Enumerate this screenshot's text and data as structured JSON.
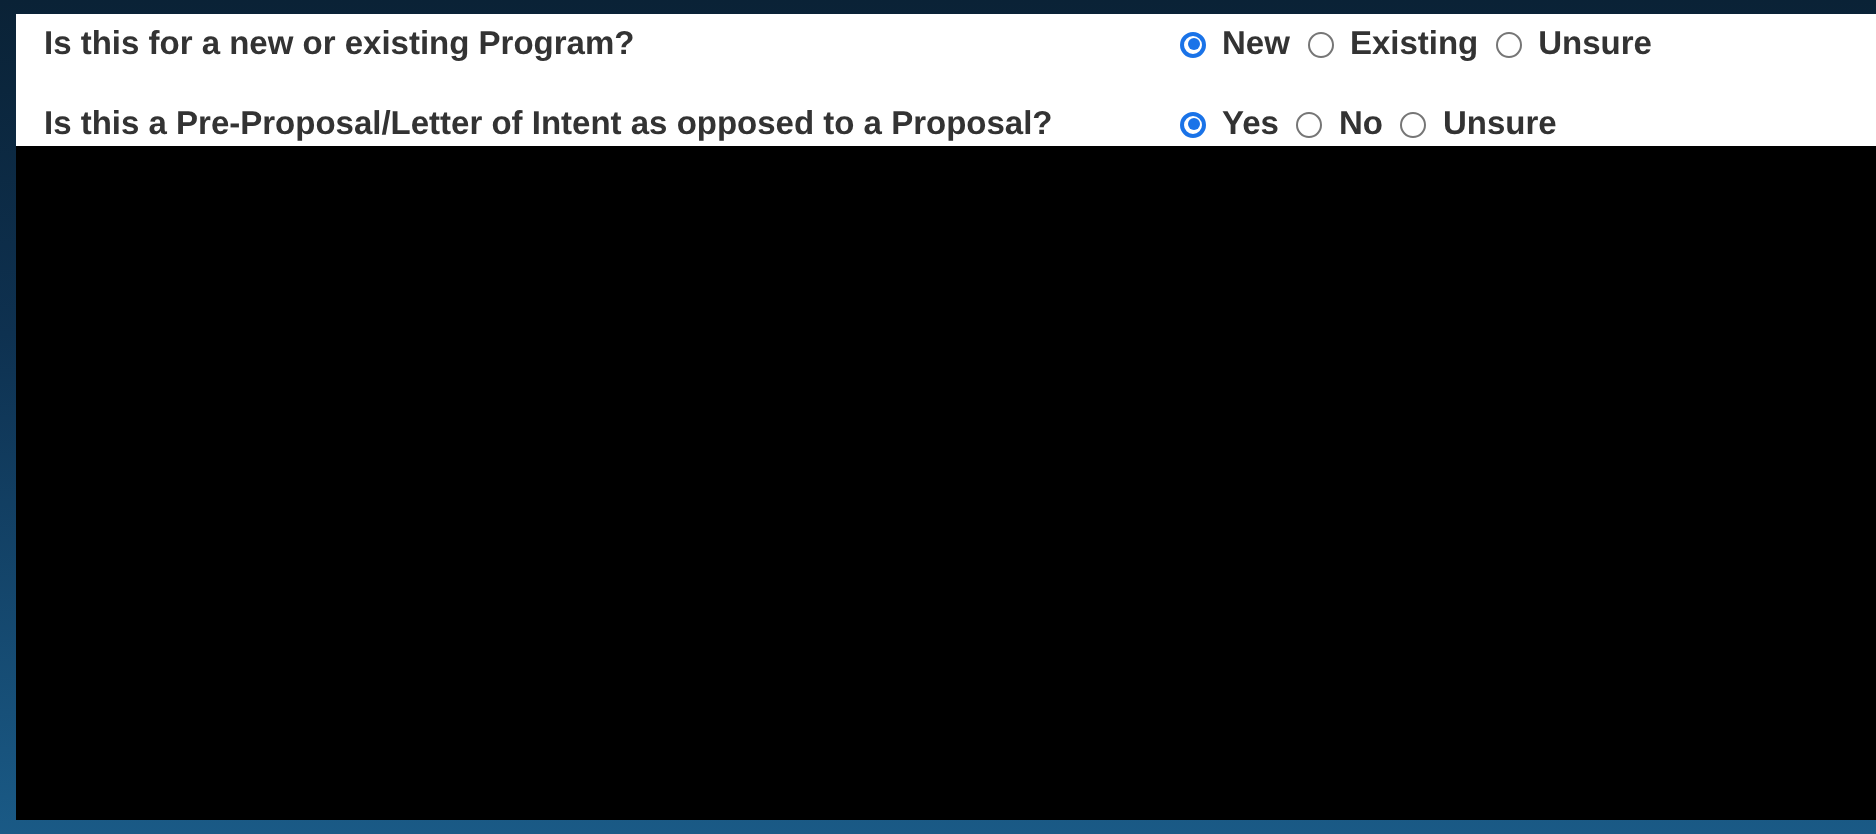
{
  "questions": [
    {
      "label": "Is this for a new or existing Program?",
      "options": [
        {
          "label": "New",
          "selected": true
        },
        {
          "label": "Existing",
          "selected": false
        },
        {
          "label": "Unsure",
          "selected": false
        }
      ]
    },
    {
      "label": "Is this a Pre-Proposal/Letter of Intent as opposed to a Proposal?",
      "options": [
        {
          "label": "Yes",
          "selected": true
        },
        {
          "label": "No",
          "selected": false
        },
        {
          "label": "Unsure",
          "selected": false
        }
      ]
    }
  ]
}
